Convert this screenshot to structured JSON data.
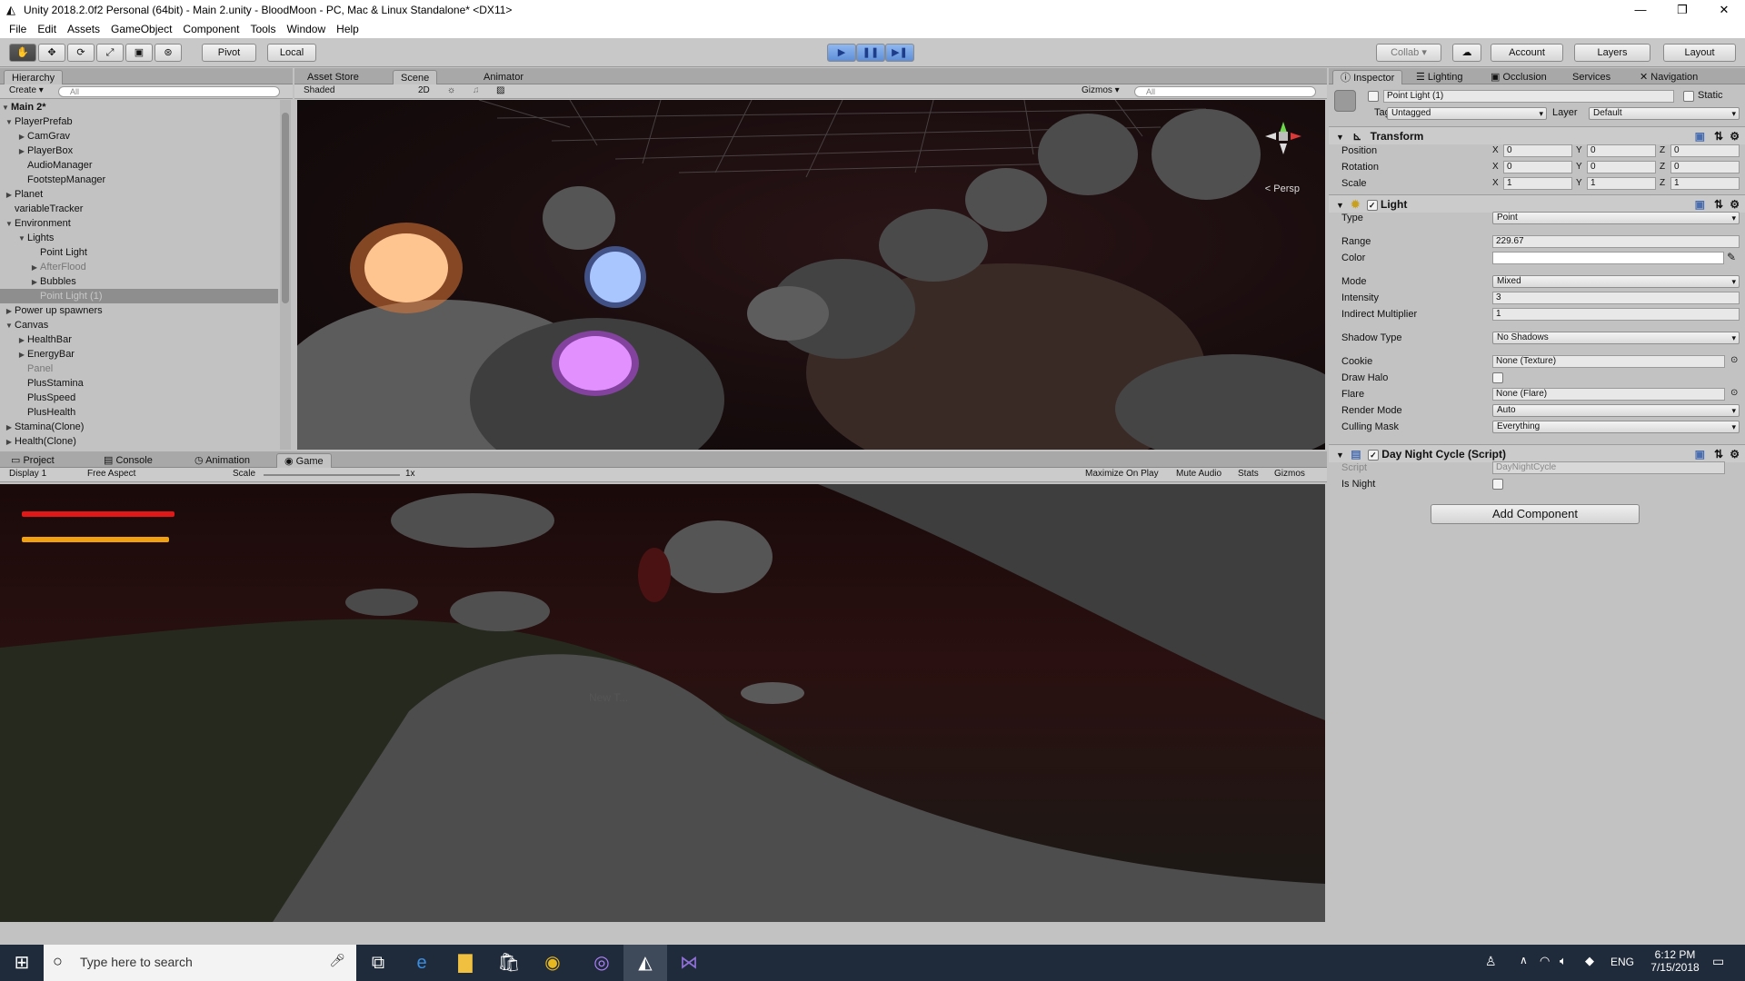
{
  "window": {
    "title": "Unity 2018.2.0f2 Personal (64bit) - Main 2.unity - BloodMoon - PC, Mac & Linux Standalone* <DX11>",
    "minimize": "—",
    "maximize": "❐",
    "close": "✕"
  },
  "menu": [
    "File",
    "Edit",
    "Assets",
    "GameObject",
    "Component",
    "Tools",
    "Window",
    "Help"
  ],
  "toolbar": {
    "tools": [
      "✋",
      "✥",
      "⟳",
      "⤢",
      "▣",
      "⊛"
    ],
    "pivot": "Pivot",
    "local": "Local",
    "play": "▶",
    "pause": "❚❚",
    "step": "▶❚",
    "collab": "Collab ▾",
    "cloud": "☁",
    "account": "Account",
    "layers": "Layers",
    "layout": "Layout"
  },
  "hierarchy": {
    "tab": "Hierarchy",
    "create": "Create ▾",
    "search_placeholder": "All",
    "scene": "Main 2*",
    "items": [
      {
        "label": "PlayerPrefab",
        "arrow": "▼",
        "indent": 1
      },
      {
        "label": "CamGrav",
        "arrow": "▶",
        "indent": 2
      },
      {
        "label": "PlayerBox",
        "arrow": "▶",
        "indent": 2
      },
      {
        "label": "AudioManager",
        "arrow": "",
        "indent": 2
      },
      {
        "label": "FootstepManager",
        "arrow": "",
        "indent": 2
      },
      {
        "label": "Planet",
        "arrow": "▶",
        "indent": 1
      },
      {
        "label": "variableTracker",
        "arrow": "",
        "indent": 1
      },
      {
        "label": "Environment",
        "arrow": "▼",
        "indent": 1
      },
      {
        "label": "Lights",
        "arrow": "▼",
        "indent": 2
      },
      {
        "label": "Point Light",
        "arrow": "",
        "indent": 3
      },
      {
        "label": "AfterFlood",
        "arrow": "▶",
        "indent": 3
      },
      {
        "label": "Bubbles",
        "arrow": "▶",
        "indent": 3
      },
      {
        "label": "Point Light (1)",
        "arrow": "",
        "indent": 3
      },
      {
        "label": "Power up spawners",
        "arrow": "▶",
        "indent": 1
      },
      {
        "label": "Canvas",
        "arrow": "▼",
        "indent": 1
      },
      {
        "label": "HealthBar",
        "arrow": "▶",
        "indent": 2
      },
      {
        "label": "EnergyBar",
        "arrow": "▶",
        "indent": 2
      },
      {
        "label": "Panel",
        "arrow": "",
        "indent": 2
      },
      {
        "label": "PlusStamina",
        "arrow": "",
        "indent": 2
      },
      {
        "label": "PlusSpeed",
        "arrow": "",
        "indent": 2
      },
      {
        "label": "PlusHealth",
        "arrow": "",
        "indent": 2
      },
      {
        "label": "Stamina(Clone)",
        "arrow": "▶",
        "indent": 1
      },
      {
        "label": "Health(Clone)",
        "arrow": "▶",
        "indent": 1
      }
    ]
  },
  "scene_tabs": [
    "Asset Store",
    "Scene",
    "Animator"
  ],
  "scene_bar": {
    "shading": "Shaded",
    "mode2d": "2D",
    "gizmos": "Gizmos ▾",
    "search_placeholder": "All",
    "persp": "< Persp"
  },
  "bottom_tabs": [
    "Project",
    "Console",
    "Animation",
    "Game"
  ],
  "game_bar": {
    "display": "Display 1",
    "aspect": "Free Aspect",
    "scale_label": "Scale",
    "scale_value": "1x",
    "maximize": "Maximize On Play",
    "mute": "Mute Audio",
    "stats": "Stats",
    "gizmos": "Gizmos"
  },
  "game_view": {
    "overlay_text": "New T..."
  },
  "inspector": {
    "tabs": [
      "Inspector",
      "Lighting",
      "Occlusion",
      "Services",
      "Navigation"
    ],
    "object_name": "Point Light (1)",
    "static_label": "Static",
    "tag_label": "Tag",
    "tag_value": "Untagged",
    "layer_label": "Layer",
    "layer_value": "Default",
    "transform": {
      "title": "Transform",
      "rows": [
        {
          "label": "Position",
          "x": "0",
          "y": "0",
          "z": "0"
        },
        {
          "label": "Rotation",
          "x": "0",
          "y": "0",
          "z": "0"
        },
        {
          "label": "Scale",
          "x": "1",
          "y": "1",
          "z": "1"
        }
      ]
    },
    "light": {
      "title": "Light",
      "type_label": "Type",
      "type_value": "Point",
      "range_label": "Range",
      "range_value": "229.67",
      "color_label": "Color",
      "color_value": "#ffffff",
      "mode_label": "Mode",
      "mode_value": "Mixed",
      "intensity_label": "Intensity",
      "intensity_value": "3",
      "indirect_label": "Indirect Multiplier",
      "indirect_value": "1",
      "shadow_label": "Shadow Type",
      "shadow_value": "No Shadows",
      "cookie_label": "Cookie",
      "cookie_value": "None (Texture)",
      "halo_label": "Draw Halo",
      "flare_label": "Flare",
      "flare_value": "None (Flare)",
      "render_label": "Render Mode",
      "render_value": "Auto",
      "culling_label": "Culling Mask",
      "culling_value": "Everything"
    },
    "script": {
      "title": "Day Night Cycle (Script)",
      "script_label": "Script",
      "script_value": "DayNightCycle",
      "night_label": "Is Night"
    },
    "add_component": "Add Component"
  },
  "taskbar": {
    "search_placeholder": "Type here to search",
    "lang": "ENG",
    "time": "6:12 PM",
    "date": "7/15/2018"
  },
  "colors": {
    "health": "#e01818",
    "energy": "#f0a010",
    "accent": "#5a8fd8"
  }
}
